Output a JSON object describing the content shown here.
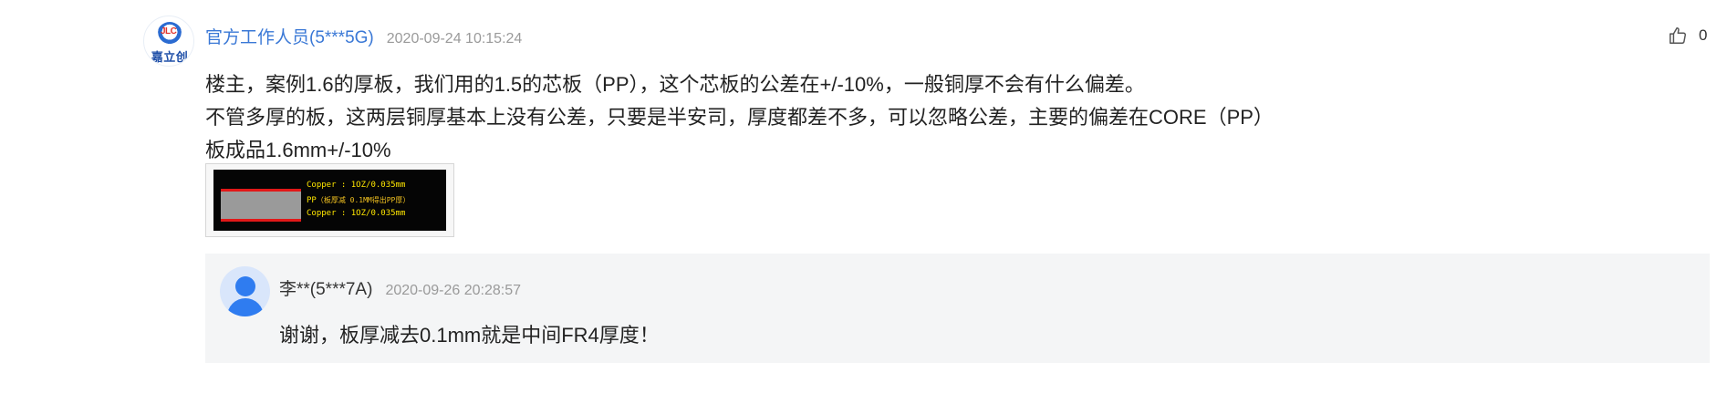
{
  "comment": {
    "avatar": {
      "logo_mark": "JLC",
      "logo_text": "嘉立创"
    },
    "username": "官方工作人员(5***5G)",
    "timestamp": "2020-09-24 10:15:24",
    "like": {
      "icon": "thumbs-up-icon",
      "count": "0"
    },
    "body_lines": [
      "楼主，案例1.6的厚板，我们用的1.5的芯板（PP），这个芯板的公差在+/-10%，一般铜厚不会有什么偏差。",
      "不管多厚的板，这两层铜厚基本上没有公差，只要是半安司，厚度都差不多，可以忽略公差，主要的偏差在CORE（PP）",
      "板成品1.6mm+/-10%"
    ],
    "attachment": {
      "line1": "Copper : 1OZ/0.035mm",
      "line2_main": "PP",
      "line2_note": "（板厚减 0.1MM得出PP厚）",
      "line3": "Copper : 1OZ/0.035mm",
      "colors": {
        "copper": "#e21818",
        "core": "#9a9a9a",
        "label": "#ffe600"
      }
    }
  },
  "reply": {
    "avatar_icon": "user-icon",
    "username": "李**(5***7A)",
    "timestamp": "2020-09-26 20:28:57",
    "text": "谢谢，板厚减去0.1mm就是中间FR4厚度！"
  },
  "colors": {
    "link": "#3a78d6",
    "meta": "#9a9a9a",
    "reply_bg": "#f4f5f6",
    "avatar_blue": "#2f7cf0"
  }
}
